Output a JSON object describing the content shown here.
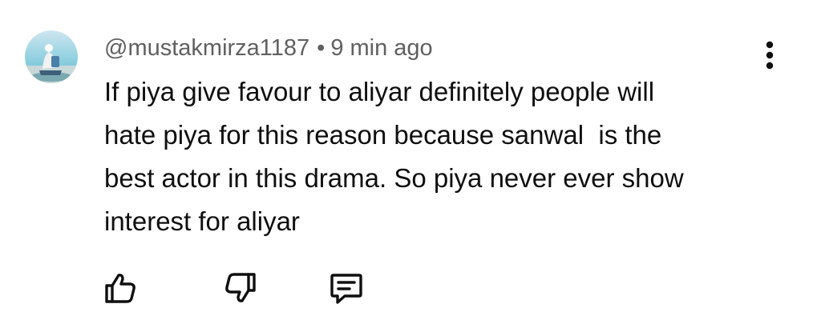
{
  "comment": {
    "author": "@mustakmirza1187",
    "separator": "•",
    "time": "9 min ago",
    "lines": [
      "If piya give favour to aliyar definitely people will",
      "hate piya for this reason because sanwal  is the",
      "best actor in this drama. So piya never ever show",
      "interest for aliyar"
    ]
  },
  "icons": {
    "avatar": "user-avatar",
    "more": "more-vert-icon",
    "like": "thumb-up-icon",
    "dislike": "thumb-down-icon",
    "reply": "reply-comment-icon"
  },
  "colors": {
    "text": "#0f0f0f",
    "meta": "#606060",
    "icon": "#0f0f0f"
  }
}
